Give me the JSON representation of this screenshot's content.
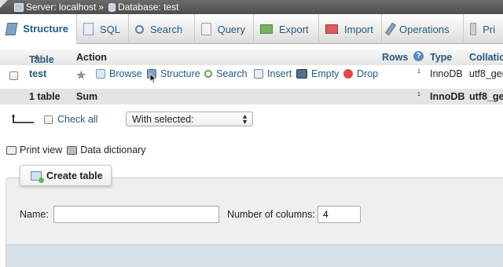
{
  "breadcrumb": {
    "server": "Server: localhost",
    "separator": "»",
    "database": "Database: test"
  },
  "tabs": [
    {
      "label": "Structure",
      "icon": "structure-icon",
      "active": true
    },
    {
      "label": "SQL",
      "icon": "sql-icon"
    },
    {
      "label": "Search",
      "icon": "search-icon"
    },
    {
      "label": "Query",
      "icon": "query-icon"
    },
    {
      "label": "Export",
      "icon": "export-icon"
    },
    {
      "label": "Import",
      "icon": "import-icon"
    },
    {
      "label": "Operations",
      "icon": "operations-icon"
    },
    {
      "label": "Pri",
      "icon": "privileges-icon"
    }
  ],
  "table_header": {
    "table": "Table",
    "action": "Action",
    "rows": "Rows",
    "help": "?",
    "type": "Type",
    "collation": "Collatio"
  },
  "table_row": {
    "name": "test",
    "actions": {
      "browse": "Browse",
      "structure": "Structure",
      "search": "Search",
      "insert": "Insert",
      "empty": "Empty",
      "drop": "Drop"
    },
    "rows": "1",
    "type": "InnoDB",
    "collation": "utf8_ger"
  },
  "summary_row": {
    "count": "1 table",
    "label": "Sum",
    "rows": "1",
    "type": "InnoDB",
    "collation": "utf8_ger"
  },
  "check_bar": {
    "check_all": "Check all",
    "with_selected": "With selected:"
  },
  "links": {
    "print_view": "Print view",
    "data_dictionary": "Data dictionary"
  },
  "create_table": {
    "button": "Create table",
    "name_label": "Name:",
    "name_value": "",
    "columns_label": "Number of columns:",
    "columns_value": "4"
  },
  "colors": {
    "link": "#235a81",
    "breadcrumb_bg": "#5a5a5a",
    "summary_bg": "#e4e4e4"
  }
}
